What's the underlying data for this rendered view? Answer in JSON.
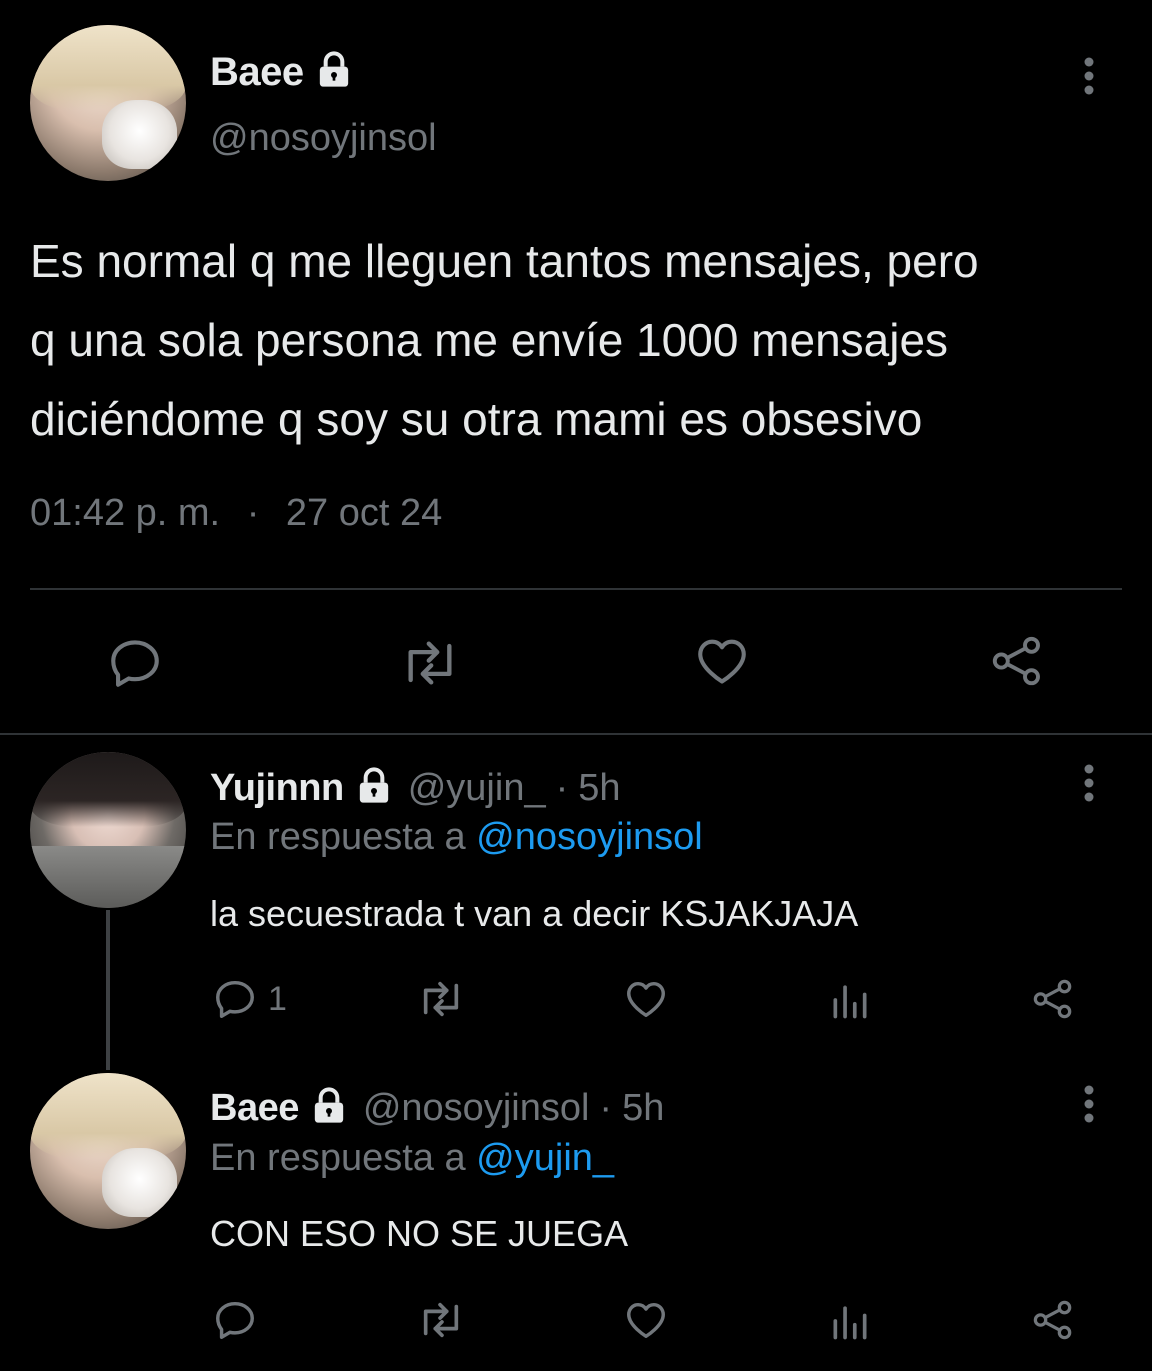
{
  "main_tweet": {
    "display_name": "Baee",
    "handle": "@nosoyjinsol",
    "text_lines": [
      "Es normal q me lleguen tantos mensajes, pero",
      "q una sola persona me envíe 1000 mensajes",
      "diciéndome q soy su otra mami es obsesivo"
    ],
    "time": "01:42 p. m.",
    "separator": "·",
    "date": "27 oct 24"
  },
  "reply_1": {
    "display_name": "Yujinnn",
    "handle": "@yujin_",
    "dot": "·",
    "age": "5h",
    "reply_prefix": "En respuesta a",
    "reply_to": "@nosoyjinsol",
    "text": "la secuestrada t van a decir KSJAKJAJA",
    "reply_count": "1"
  },
  "reply_2": {
    "display_name": "Baee",
    "handle": "@nosoyjinsol",
    "dot": "·",
    "age": "5h",
    "reply_prefix": "En respuesta a",
    "reply_to": "@yujin_",
    "text": "CON ESO NO SE JUEGA"
  },
  "colors": {
    "background": "#000000",
    "text": "#e7e9ea",
    "muted": "#71767b",
    "link": "#1d9bf0",
    "divider": "#2f3336"
  },
  "icons": [
    "lock-icon",
    "more-icon",
    "reply-icon",
    "retweet-icon",
    "like-icon",
    "share-icon",
    "views-icon"
  ]
}
